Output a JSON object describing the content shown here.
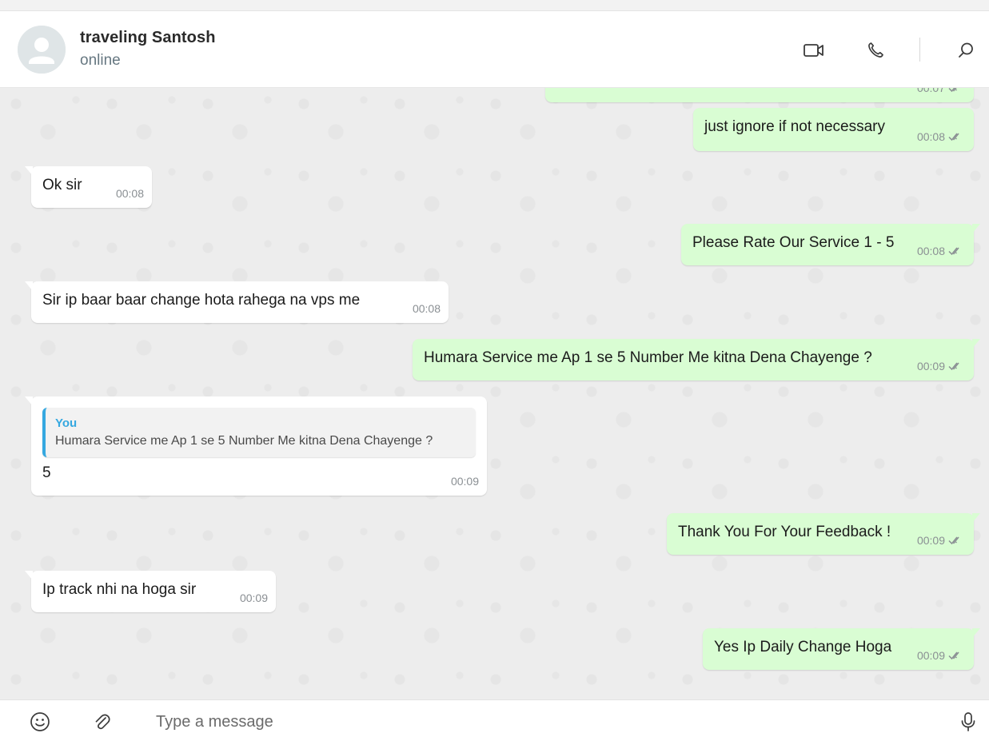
{
  "header": {
    "contact_name": "traveling Santosh",
    "contact_status": "online",
    "actions": [
      "video-call-icon",
      "voice-call-icon",
      "search-icon"
    ]
  },
  "messages": [
    {
      "direction": "out",
      "text": "",
      "time": "00:07",
      "partial": true
    },
    {
      "direction": "out",
      "text": "just ignore if not necessary",
      "time": "00:08"
    },
    {
      "direction": "in",
      "text": "Ok sir",
      "time": "00:08"
    },
    {
      "direction": "out",
      "text": "Please Rate Our Service 1 - 5",
      "time": "00:08"
    },
    {
      "direction": "in",
      "text": "Sir ip baar baar change hota rahega na vps me",
      "time": "00:08"
    },
    {
      "direction": "out",
      "text": "Humara Service me Ap 1 se 5 Number Me kitna Dena Chayenge ?",
      "time": "00:09"
    },
    {
      "direction": "in",
      "text": "5",
      "time": "00:09",
      "reply_to": {
        "author": "You",
        "text": "Humara Service me Ap 1 se 5 Number Me kitna Dena Chayenge ?"
      }
    },
    {
      "direction": "out",
      "text": "Thank You For Your Feedback !",
      "time": "00:09"
    },
    {
      "direction": "in",
      "text": "Ip track nhi na hoga sir",
      "time": "00:09"
    },
    {
      "direction": "out",
      "text": "Yes Ip Daily Change Hoga",
      "time": "00:09"
    }
  ],
  "composer": {
    "placeholder": "Type a message",
    "value": "",
    "icons": [
      "emoji-icon",
      "attach-icon",
      "microphone-icon"
    ]
  },
  "colors": {
    "outgoing_bubble": "#d9fdd3",
    "incoming_bubble": "#ffffff",
    "quote_accent": "#35a8e0",
    "chat_background": "#ededed"
  }
}
